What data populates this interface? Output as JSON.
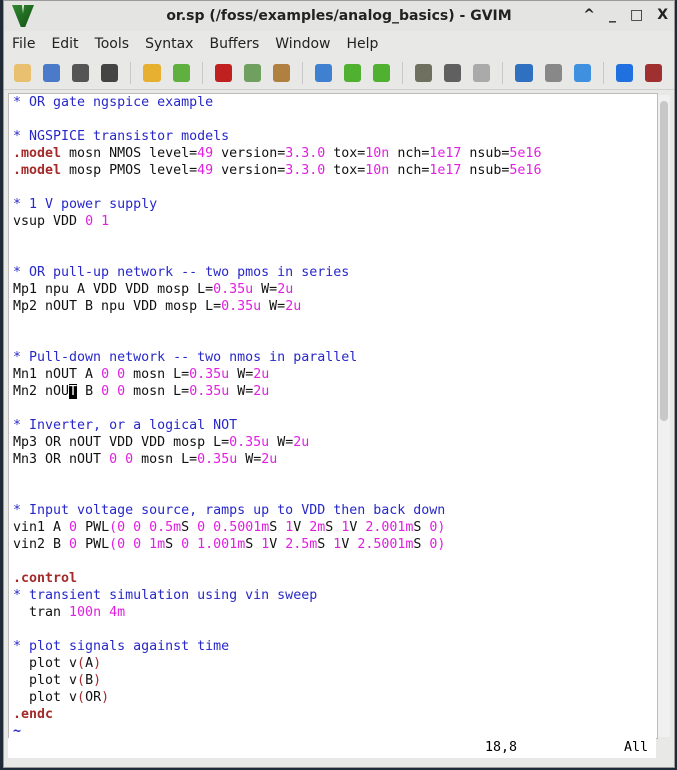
{
  "window": {
    "title": "or.sp (/foss/examples/analog_basics) - GVIM",
    "controls": [
      "^",
      "_",
      "□",
      "X"
    ]
  },
  "menu": [
    "File",
    "Edit",
    "Tools",
    "Syntax",
    "Buffers",
    "Window",
    "Help"
  ],
  "toolbar": [
    {
      "name": "open-icon",
      "color": "#e8c070"
    },
    {
      "name": "save-download-icon",
      "color": "#4a7ac8"
    },
    {
      "name": "save-icon",
      "color": "#555"
    },
    {
      "name": "print-icon",
      "color": "#444"
    },
    "sep",
    {
      "name": "undo-icon",
      "color": "#e8b030"
    },
    {
      "name": "redo-icon",
      "color": "#60b040"
    },
    "sep",
    {
      "name": "cut-icon",
      "color": "#c02020"
    },
    {
      "name": "copy-icon",
      "color": "#70a060"
    },
    {
      "name": "paste-icon",
      "color": "#b08040"
    },
    "sep",
    {
      "name": "find-replace-icon",
      "color": "#4080d0"
    },
    {
      "name": "find-next-icon",
      "color": "#50b030"
    },
    {
      "name": "find-prev-icon",
      "color": "#50b030"
    },
    "sep",
    {
      "name": "load-session-icon",
      "color": "#707060"
    },
    {
      "name": "save-session-icon",
      "color": "#606060"
    },
    {
      "name": "run-script-icon",
      "color": "#aaa"
    },
    "sep",
    {
      "name": "make-icon",
      "color": "#3070c0"
    },
    {
      "name": "shell-icon",
      "color": "#888"
    },
    {
      "name": "ctags-jump-icon",
      "color": "#4090e0"
    },
    "sep",
    {
      "name": "help-icon",
      "color": "#2070e0"
    },
    {
      "name": "find-help-icon",
      "color": "#a03030"
    }
  ],
  "lines": [
    [
      [
        "* OR gate ngspice example",
        "c"
      ]
    ],
    [],
    [
      [
        "* NGSPICE transistor models",
        "c"
      ]
    ],
    [
      [
        ".model",
        "k"
      ],
      [
        " mosn NMOS level=",
        ""
      ],
      [
        "49",
        "n"
      ],
      [
        " version=",
        ""
      ],
      [
        "3.3.0",
        "n"
      ],
      [
        " tox=",
        ""
      ],
      [
        "10n",
        "n"
      ],
      [
        " nch=",
        ""
      ],
      [
        "1e17",
        "n"
      ],
      [
        " nsub=",
        ""
      ],
      [
        "5e16",
        "n"
      ]
    ],
    [
      [
        ".model",
        "k"
      ],
      [
        " mosp PMOS level=",
        ""
      ],
      [
        "49",
        "n"
      ],
      [
        " version=",
        ""
      ],
      [
        "3.3.0",
        "n"
      ],
      [
        " tox=",
        ""
      ],
      [
        "10n",
        "n"
      ],
      [
        " nch=",
        ""
      ],
      [
        "1e17",
        "n"
      ],
      [
        " nsub=",
        ""
      ],
      [
        "5e16",
        "n"
      ]
    ],
    [],
    [
      [
        "* 1 V power supply",
        "c"
      ]
    ],
    [
      [
        "vsup VDD ",
        ""
      ],
      [
        "0",
        "n"
      ],
      [
        " ",
        ""
      ],
      [
        "1",
        "n"
      ]
    ],
    [],
    [],
    [
      [
        "* OR pull-up network -- two pmos in series",
        "c"
      ]
    ],
    [
      [
        "Mp1 npu A VDD VDD mosp L=",
        ""
      ],
      [
        "0.35u",
        "n"
      ],
      [
        " W=",
        ""
      ],
      [
        "2u",
        "n"
      ]
    ],
    [
      [
        "Mp2 nOUT B npu VDD mosp L=",
        ""
      ],
      [
        "0.35u",
        "n"
      ],
      [
        " W=",
        ""
      ],
      [
        "2u",
        "n"
      ]
    ],
    [],
    [],
    [
      [
        "* Pull-down network -- two nmos in parallel",
        "c"
      ]
    ],
    [
      [
        "Mn1 nOUT A ",
        ""
      ],
      [
        "0",
        "n"
      ],
      [
        " ",
        ""
      ],
      [
        "0",
        "n"
      ],
      [
        " mosn L=",
        ""
      ],
      [
        "0.35u",
        "n"
      ],
      [
        " W=",
        ""
      ],
      [
        "2u",
        "n"
      ]
    ],
    [
      [
        "Mn2 nOU",
        ""
      ],
      [
        "T",
        "cur"
      ],
      [
        " B ",
        ""
      ],
      [
        "0",
        "n"
      ],
      [
        " ",
        ""
      ],
      [
        "0",
        "n"
      ],
      [
        " mosn L=",
        ""
      ],
      [
        "0.35u",
        "n"
      ],
      [
        " W=",
        ""
      ],
      [
        "2u",
        "n"
      ]
    ],
    [],
    [
      [
        "* Inverter, or a logical NOT",
        "c"
      ]
    ],
    [
      [
        "Mp3 OR nOUT VDD VDD mosp L=",
        ""
      ],
      [
        "0.35u",
        "n"
      ],
      [
        " W=",
        ""
      ],
      [
        "2u",
        "n"
      ]
    ],
    [
      [
        "Mn3 OR nOUT ",
        ""
      ],
      [
        "0",
        "n"
      ],
      [
        " ",
        ""
      ],
      [
        "0",
        "n"
      ],
      [
        " mosn L=",
        ""
      ],
      [
        "0.35u",
        "n"
      ],
      [
        " W=",
        ""
      ],
      [
        "2u",
        "n"
      ]
    ],
    [],
    [],
    [
      [
        "* Input voltage source, ramps up to VDD then back down",
        "c"
      ]
    ],
    [
      [
        "vin1 A ",
        ""
      ],
      [
        "0",
        "n"
      ],
      [
        " PWL",
        ""
      ],
      [
        "(0 0 0.5m",
        "n"
      ],
      [
        "S ",
        ""
      ],
      [
        "0 0.5001m",
        "n"
      ],
      [
        "S ",
        ""
      ],
      [
        "1",
        "n"
      ],
      [
        "V ",
        ""
      ],
      [
        "2m",
        "n"
      ],
      [
        "S ",
        ""
      ],
      [
        "1",
        "n"
      ],
      [
        "V ",
        ""
      ],
      [
        "2.001m",
        "n"
      ],
      [
        "S ",
        ""
      ],
      [
        "0)",
        "n"
      ]
    ],
    [
      [
        "vin2 B ",
        ""
      ],
      [
        "0",
        "n"
      ],
      [
        " PWL",
        ""
      ],
      [
        "(0 0 1m",
        "n"
      ],
      [
        "S ",
        ""
      ],
      [
        "0 1.001m",
        "n"
      ],
      [
        "S ",
        ""
      ],
      [
        "1",
        "n"
      ],
      [
        "V ",
        ""
      ],
      [
        "2.5m",
        "n"
      ],
      [
        "S ",
        ""
      ],
      [
        "1",
        "n"
      ],
      [
        "V ",
        ""
      ],
      [
        "2.5001m",
        "n"
      ],
      [
        "S ",
        ""
      ],
      [
        "0)",
        "n"
      ]
    ],
    [],
    [
      [
        ".control",
        "k"
      ]
    ],
    [
      [
        "* transient simulation using vin sweep",
        "c"
      ]
    ],
    [
      [
        "  tran ",
        ""
      ],
      [
        "100n 4m",
        "n"
      ]
    ],
    [],
    [
      [
        "* plot signals against time",
        "c"
      ]
    ],
    [
      [
        "  plot v",
        ""
      ],
      [
        "(",
        "p"
      ],
      [
        "A",
        ""
      ],
      [
        ")",
        "p"
      ]
    ],
    [
      [
        "  plot v",
        ""
      ],
      [
        "(",
        "p"
      ],
      [
        "B",
        ""
      ],
      [
        ")",
        "p"
      ]
    ],
    [
      [
        "  plot v",
        ""
      ],
      [
        "(",
        "p"
      ],
      [
        "OR",
        ""
      ],
      [
        ")",
        "p"
      ]
    ],
    [
      [
        ".endc",
        "k"
      ]
    ],
    [
      [
        "~",
        "t"
      ]
    ]
  ],
  "status": {
    "position": "18,8",
    "scroll": "All"
  }
}
